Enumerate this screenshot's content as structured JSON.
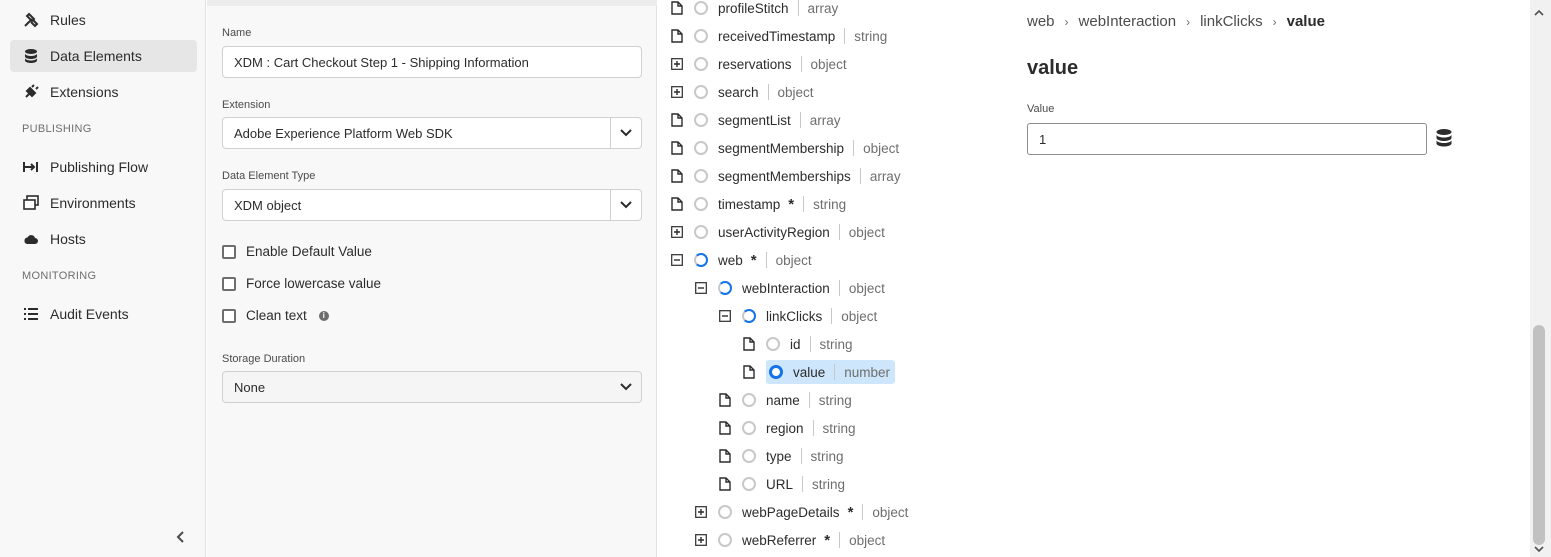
{
  "nav": {
    "items": [
      {
        "label": "Rules",
        "icon": "rules-icon"
      },
      {
        "label": "Data Elements",
        "icon": "database-icon"
      },
      {
        "label": "Extensions",
        "icon": "plug-icon"
      },
      {
        "label": "Publishing Flow",
        "icon": "publishing-flow-icon"
      },
      {
        "label": "Environments",
        "icon": "environments-icon"
      },
      {
        "label": "Hosts",
        "icon": "cloud-icon"
      },
      {
        "label": "Audit Events",
        "icon": "list-icon"
      }
    ],
    "sections": {
      "publishing": "PUBLISHING",
      "monitoring": "MONITORING"
    }
  },
  "form": {
    "name_label": "Name",
    "name_value": "XDM : Cart Checkout Step 1 - Shipping Information",
    "extension_label": "Extension",
    "extension_value": "Adobe Experience Platform Web SDK",
    "type_label": "Data Element Type",
    "type_value": "XDM object",
    "checkboxes": [
      {
        "label": "Enable Default Value",
        "checked": false
      },
      {
        "label": "Force lowercase value",
        "checked": false
      },
      {
        "label": "Clean text",
        "checked": false
      }
    ],
    "storage_label": "Storage Duration",
    "storage_value": "None"
  },
  "tree": {
    "rows": [
      {
        "name": "profileStitch",
        "type": "array"
      },
      {
        "name": "receivedTimestamp",
        "type": "string"
      },
      {
        "name": "reservations",
        "type": "object"
      },
      {
        "name": "search",
        "type": "object"
      },
      {
        "name": "segmentList",
        "type": "array"
      },
      {
        "name": "segmentMembership",
        "type": "object"
      },
      {
        "name": "segmentMemberships",
        "type": "array"
      },
      {
        "name": "timestamp",
        "type": "string",
        "required": "*"
      },
      {
        "name": "userActivityRegion",
        "type": "object"
      },
      {
        "name": "web",
        "type": "object",
        "required": "*"
      },
      {
        "name": "webInteraction",
        "type": "object"
      },
      {
        "name": "linkClicks",
        "type": "object"
      },
      {
        "name": "id",
        "type": "string"
      },
      {
        "name": "value",
        "type": "number"
      },
      {
        "name": "name",
        "type": "string"
      },
      {
        "name": "region",
        "type": "string"
      },
      {
        "name": "type",
        "type": "string"
      },
      {
        "name": "URL",
        "type": "string"
      },
      {
        "name": "webPageDetails",
        "type": "object",
        "required": "*"
      },
      {
        "name": "webReferrer",
        "type": "object",
        "required": "*"
      }
    ]
  },
  "detail": {
    "breadcrumb": [
      "web",
      "webInteraction",
      "linkClicks",
      "value"
    ],
    "title": "value",
    "value_label": "Value",
    "value": "1"
  },
  "colors": {
    "accent": "#1473e6",
    "selected_bg": "#cde6fb"
  }
}
